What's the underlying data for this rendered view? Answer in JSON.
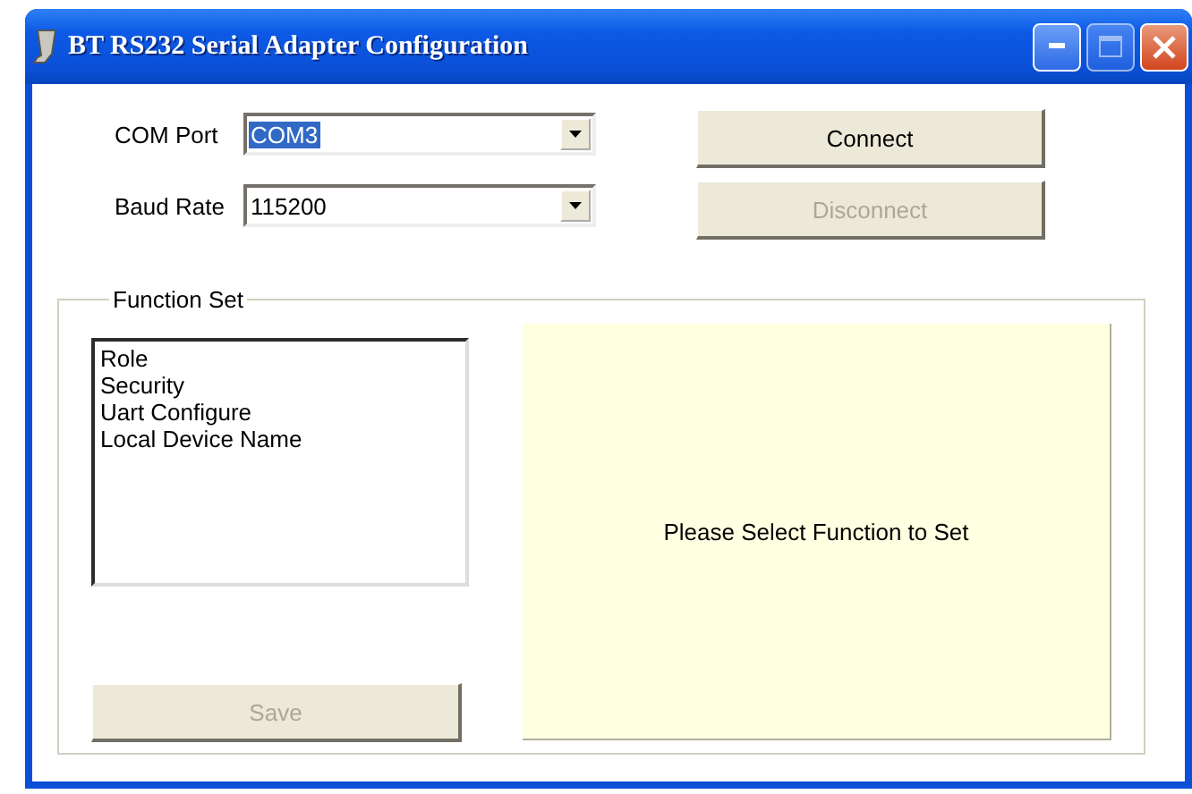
{
  "window": {
    "title": "BT RS232 Serial Adapter Configuration"
  },
  "settings": [
    {
      "label": "COM Port",
      "value": "COM3",
      "highlighted": true
    },
    {
      "label": "Baud Rate",
      "value": "115200",
      "highlighted": false
    }
  ],
  "buttons": [
    {
      "label": "Connect",
      "disabled": false
    },
    {
      "label": "Disconnect",
      "disabled": true
    }
  ],
  "function_set": {
    "title": "Function Set",
    "items": [
      "Role",
      "Security",
      "Uart Configure",
      "Local Device Name"
    ],
    "save": {
      "label": "Save",
      "disabled": true
    },
    "message": "Please Select Function to Set"
  }
}
